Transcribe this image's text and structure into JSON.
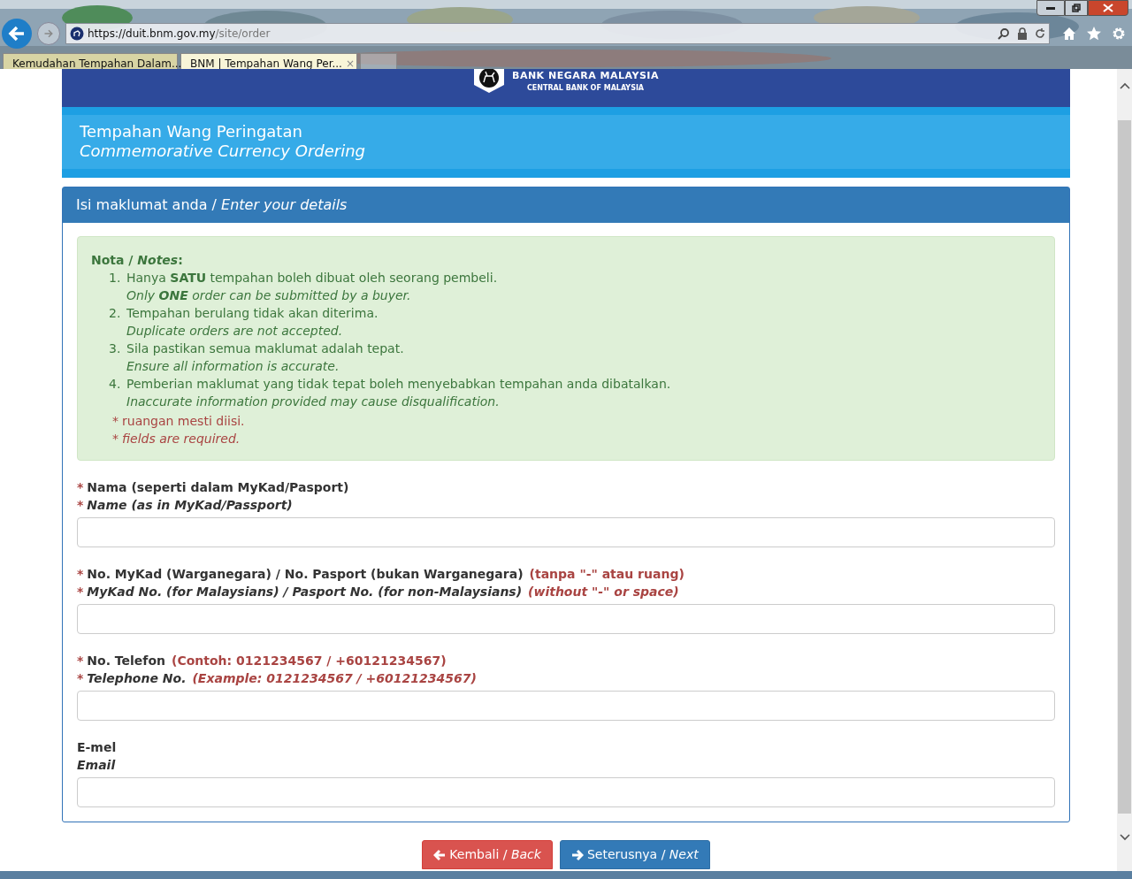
{
  "browser": {
    "url_host": "https://duit.bnm.gov.my",
    "url_path": "/site/order",
    "tabs": [
      {
        "title": "Kemudahan Tempahan Dalam...",
        "selected": false
      },
      {
        "title": "BNM | Tempahan Wang Per...",
        "selected": true,
        "close": "×"
      }
    ]
  },
  "header": {
    "bank_name": "BANK NEGARA MALAYSIA",
    "bank_subtitle": "CENTRAL BANK OF MALAYSIA"
  },
  "banner": {
    "title": "Tempahan Wang Peringatan",
    "subtitle": "Commemorative Currency Ordering"
  },
  "panel": {
    "heading": "Isi maklumat anda / *Enter your details*",
    "notes": {
      "title": "Nota / *Notes*:",
      "items": [
        {
          "number": "1.",
          "ms": "Hanya **SATU** tempahan boleh dibuat oleh seorang pembeli.",
          "en": "Only **ONE** order can be submitted by a buyer."
        },
        {
          "number": "2.",
          "ms": "Tempahan berulang tidak akan diterima.",
          "en": "Duplicate orders are not accepted."
        },
        {
          "number": "3.",
          "ms": "Sila pastikan semua maklumat adalah tepat.",
          "en": "Ensure all information is accurate."
        },
        {
          "number": "4.",
          "ms": "Pemberian maklumat yang tidak tepat boleh menyebabkan tempahan anda dibatalkan.",
          "en": "Inaccurate information provided may cause disqualification."
        }
      ],
      "required": [
        {
          "marker": "*",
          "text": "ruangan mesti diisi."
        },
        {
          "marker": "*",
          "text": "fields are required."
        }
      ]
    },
    "fields": [
      {
        "lines": [
          {
            "marker": "*",
            "text": "Nama (seperti dalam MyKad/Pasport)"
          },
          {
            "marker": "*",
            "text": "Name (as in MyKad/Passport)"
          }
        ]
      },
      {
        "lines": [
          {
            "marker": "*",
            "text": "No. MyKad (Warganegara) / No. Pasport (bukan Warganegara)",
            "hint": "(tanpa \"-\" atau ruang)"
          },
          {
            "marker": "*",
            "text": "MyKad No. (for Malaysians) / Pasport No. (for non-Malaysians)",
            "hint": "(without \"-\" or space)"
          }
        ]
      },
      {
        "lines": [
          {
            "marker": "*",
            "text": "No. Telefon",
            "hint": "(Contoh: 0121234567 / +60121234567)"
          },
          {
            "marker": "*",
            "text": "Telephone No.",
            "hint": "(Example: 0121234567 / +60121234567)"
          }
        ]
      },
      {
        "lines": [
          {
            "text": "E-mel"
          },
          {
            "text": "Email"
          }
        ]
      }
    ]
  },
  "buttons": [
    {
      "kind": "back",
      "label": "Kembali / *Back*"
    },
    {
      "kind": "next",
      "label": "Seterusnya / *Next*"
    }
  ]
}
